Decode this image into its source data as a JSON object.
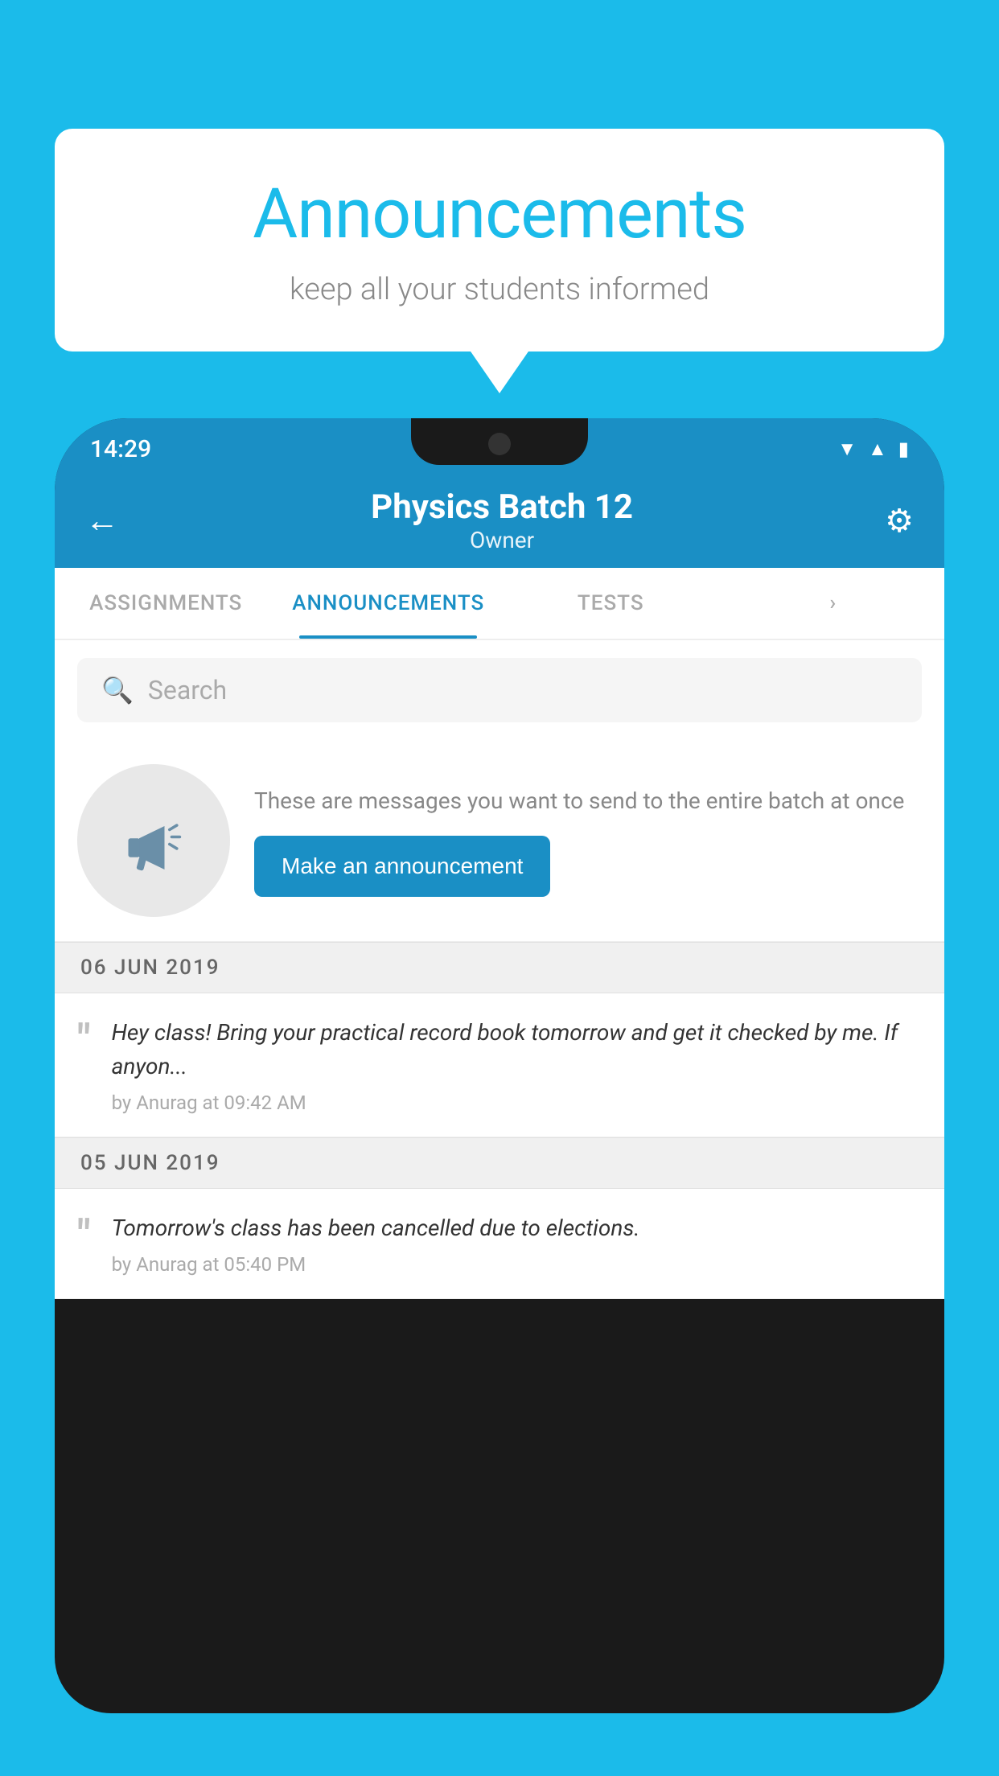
{
  "background_color": "#1BBBEA",
  "speech_bubble": {
    "title": "Announcements",
    "subtitle": "keep all your students informed"
  },
  "status_bar": {
    "time": "14:29",
    "icons": [
      "wifi",
      "signal",
      "battery"
    ]
  },
  "app_bar": {
    "title": "Physics Batch 12",
    "subtitle": "Owner",
    "back_label": "←",
    "settings_label": "⚙"
  },
  "tabs": [
    {
      "label": "ASSIGNMENTS",
      "active": false
    },
    {
      "label": "ANNOUNCEMENTS",
      "active": true
    },
    {
      "label": "TESTS",
      "active": false
    },
    {
      "label": "›",
      "active": false
    }
  ],
  "search": {
    "placeholder": "Search"
  },
  "announcement_prompt": {
    "description_text": "These are messages you want to send to the entire batch at once",
    "button_label": "Make an announcement"
  },
  "date_groups": [
    {
      "date": "06  JUN  2019",
      "items": [
        {
          "message": "Hey class! Bring your practical record book tomorrow and get it checked by me. If anyon...",
          "meta": "by Anurag at 09:42 AM"
        }
      ]
    },
    {
      "date": "05  JUN  2019",
      "items": [
        {
          "message": "Tomorrow's class has been cancelled due to elections.",
          "meta": "by Anurag at 05:40 PM"
        }
      ]
    }
  ]
}
